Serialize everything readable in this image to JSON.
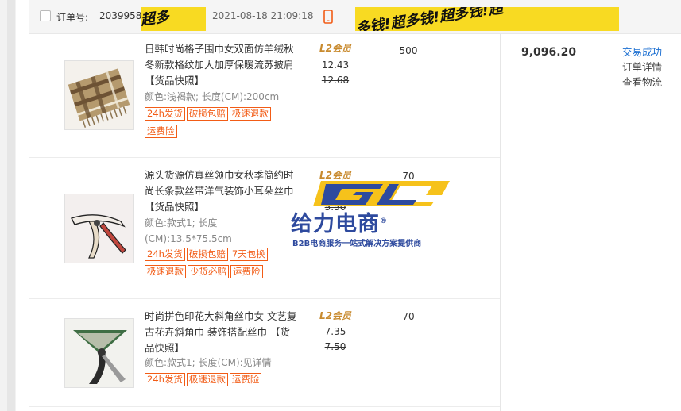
{
  "order": {
    "checkbox_checked": false,
    "order_no_label": "订单号:",
    "order_no_value": "2039958",
    "time": "2021-08-18 21:09:18",
    "banner_text": "多钱!超多钱!超多钱!超",
    "banner_fragment": "超多",
    "total": "9,096.20",
    "status": "交易成功",
    "detail_link": "订单详情",
    "logistics_link": "查看物流"
  },
  "products": [
    {
      "title": "日韩时尚格子围巾女双面仿羊绒秋冬新款格纹加大加厚保暖流苏披肩 【货品快照】",
      "attrs": "颜色:浅褐款; 长度(CM):200cm",
      "badges": [
        "24h发货",
        "破损包赔",
        "极速退款",
        "运费险"
      ],
      "level": "L2会员",
      "price": "12.43",
      "price_old": "12.68",
      "qty": "500"
    },
    {
      "title": "源头货源仿真丝领巾女秋季简约时尚长条款丝带洋气装饰小耳朵丝巾 【货品快照】",
      "attrs": "颜色:款式1; 长度(CM):13.5*75.5cm",
      "badges": [
        "24h发货",
        "破损包赔",
        "7天包换",
        "极速退款",
        "少货必赔",
        "运费险"
      ],
      "level": "L2会员",
      "price": "",
      "price_old": "5.50",
      "qty": "70"
    },
    {
      "title": "时尚拼色印花大斜角丝巾女 文艺复古花卉斜角巾 装饰搭配丝巾 【货品快照】",
      "attrs": "颜色:款式1; 长度(CM):见详情",
      "badges": [
        "24h发货",
        "极速退款",
        "运费险"
      ],
      "level": "L2会员",
      "price": "7.35",
      "price_old": "7.50",
      "qty": "70"
    }
  ],
  "watermark": {
    "brand_en": "GL",
    "brand_cn": "给力电商",
    "reg": "®",
    "tagline": "B2B电商服务一站式解决方案提供商"
  },
  "colors": {
    "badge": "#f25c16",
    "status_link": "#1c6fd1",
    "member_gold": "#d9a04b",
    "banner_yellow": "#f8da22",
    "watermark_blue": "#2e4a9e",
    "watermark_yellow": "#f6c21b"
  }
}
